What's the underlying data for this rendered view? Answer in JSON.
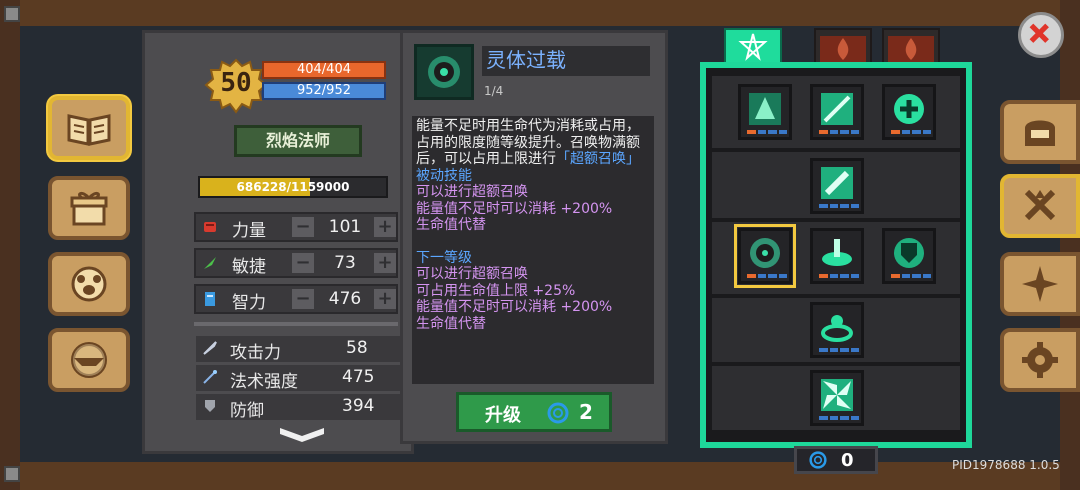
{
  "character": {
    "level": "50",
    "hp": "404/404",
    "mp": "952/952",
    "class_name": "烈焰法师",
    "exp": "686228/1159000",
    "exp_progress": 0.592
  },
  "attributes": [
    {
      "label": "力量",
      "value": "101"
    },
    {
      "label": "敏捷",
      "value": "73"
    },
    {
      "label": "智力",
      "value": "476"
    }
  ],
  "stats": [
    {
      "label": "攻击力",
      "value": "58"
    },
    {
      "label": "法术强度",
      "value": "475"
    },
    {
      "label": "防御",
      "value": "394"
    }
  ],
  "skill": {
    "name": "灵体过载",
    "level": "1/4",
    "desc_main": "能量不足时用生命代为消耗或占用，占用的限度随等级提升。召唤物满额后，可以占用上限进行",
    "desc_link": "「超额召唤」",
    "passive_title": "被动技能",
    "passive_lines": [
      "可以进行超额召唤",
      "能量值不足时可以消耗 +200%",
      "生命值代替"
    ],
    "next_title": "下一等级",
    "next_lines": [
      "可以进行超额召唤",
      "可占用生命值上限 +25%",
      "能量值不足时可以消耗 +200%",
      "生命值代替"
    ],
    "upgrade_label": "升级",
    "upgrade_cost": "2"
  },
  "talent": {
    "points": "0"
  },
  "footer": {
    "pid": "PID1978688 1.0.5"
  },
  "colors": {
    "accent_green": "#1ed89a",
    "hp": "#e9672c",
    "mp": "#4a8ad8",
    "exp": "#d9b21c",
    "text_blue": "#5ba6ff",
    "text_purple": "#d494f0"
  }
}
